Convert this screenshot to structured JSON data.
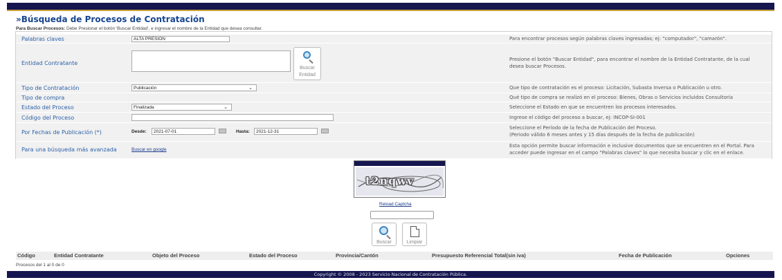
{
  "page": {
    "title": "»Búsqueda de Procesos de Contratación",
    "instructions_bold": "Para Buscar Procesos:",
    "instructions_text": " Debe Presionar el botón 'Buscar Entidad', e ingresar el nombre de la Entidad que desea consultar."
  },
  "form": {
    "palabras": {
      "label": "Palabras claves",
      "value": "ALTA PRESION",
      "help": "Para encontrar procesos según palabras claves ingresadas; ej: \"computador\", \"camarón\"."
    },
    "entidad": {
      "label": "Entidad Contratante",
      "value": "",
      "button_line1": "Buscar",
      "button_line2": "Entidad",
      "help_line1": "Presione el botón \"Buscar Entidad\", para encontrar el nombre de la Entidad Contratante, de la cual",
      "help_line2": "desea buscar Procesos."
    },
    "tipo_contratacion": {
      "label": "Tipo de Contratación",
      "selected": "Publicación",
      "help": "Que tipo de contratación es el proceso: Licitación, Subasta Inversa o Publicación u otro."
    },
    "tipo_compra": {
      "label": "Tipo de compra",
      "help": "Qué tipo de compra se realizó en el proceso: Bienes, Obras o Servicios incluidos Consultoría"
    },
    "estado": {
      "label": "Estado del Proceso",
      "selected": "Finalizada",
      "help": "Seleccione el Estado en que se encuentren los procesos interesados."
    },
    "codigo": {
      "label": "Código del Proceso",
      "value": "",
      "help": "Ingrese el código del proceso a buscar, ej: INCOP-SI-001"
    },
    "fechas": {
      "label": "Por Fechas de Publicación (*)",
      "desde_label": "Desde:",
      "desde_value": "2021-07-01",
      "hasta_label": "Hasta:",
      "hasta_value": "2021-12-31",
      "help_line1": "Seleccione el Período de la fecha de Publicación del Proceso.",
      "help_line2": "(Periodo válido 6 meses antes y 15 días después de la fecha de publicación)"
    },
    "avanzada": {
      "label": "Para una búsqueda más avanzada",
      "link": "Buscar en google",
      "help_line1": "Esta opción permite buscar información e inclusive documentos que se encuentren en el Portal. Para",
      "help_line2": "acceder puede ingresar en el campo \"Palabras claves\" lo que necesita buscar y clic en el enlace."
    }
  },
  "captcha": {
    "text": "t2nqwv",
    "reload_label": "Reload Captcha",
    "input_value": ""
  },
  "actions": {
    "buscar_label": "Buscar",
    "limpiar_label": "Limpiar"
  },
  "results": {
    "columns": [
      "Código",
      "Entidad Contratante",
      "Objeto del Proceso",
      "Estado del Proceso",
      "Provincia/Cantón",
      "Presupuesto Referencial Total(sin iva)",
      "Fecha de Publicación",
      "Opciones"
    ],
    "count_text": "Procesos del 1 al 0 de 0"
  },
  "footer": {
    "text": "Copyright © 2008 - 2023 Servicio Nacional de Contratación Pública."
  },
  "colors": {
    "navy": "#15154f",
    "gold": "#c9a23a",
    "label_blue": "#2a5fa8",
    "title_blue": "#17458f"
  }
}
